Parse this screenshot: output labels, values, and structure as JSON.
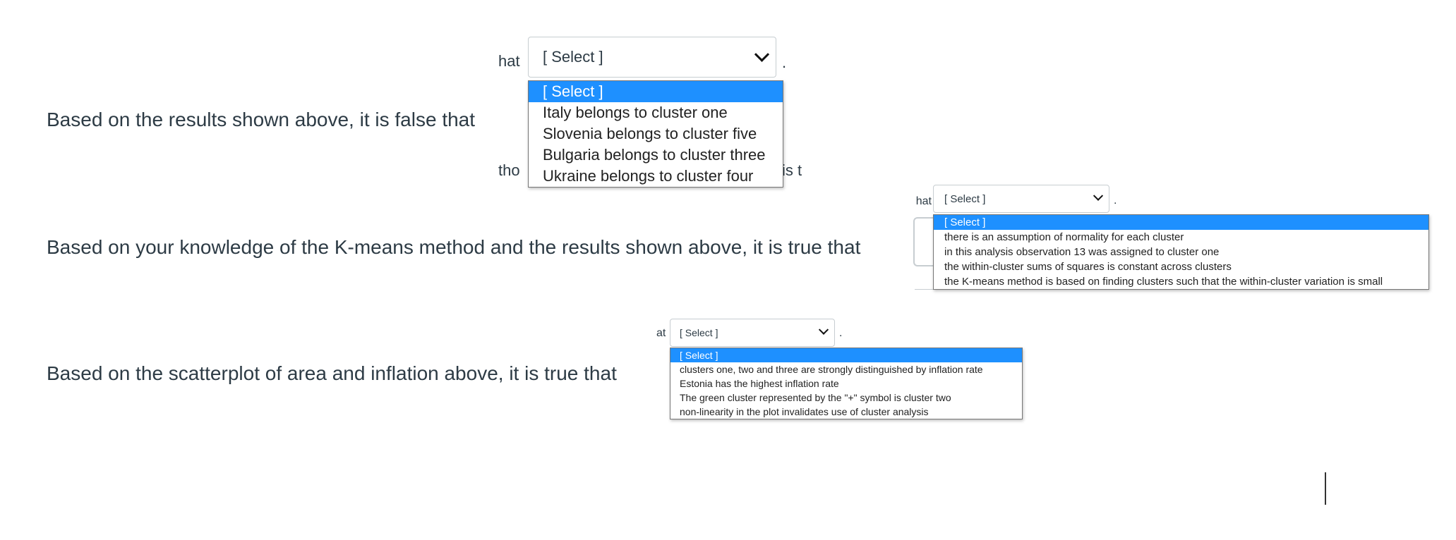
{
  "questions": [
    {
      "text": "Based on the results shown above, it is false that",
      "fragment_before": "hat",
      "fragment_below_left": "tho",
      "fragment_below_right": "is t",
      "select_value": "[ Select ]",
      "period": ".",
      "options": [
        "[ Select ]",
        "Italy belongs to cluster one",
        "Slovenia belongs to cluster five",
        "Bulgaria belongs to cluster three",
        "Ukraine belongs to cluster four"
      ]
    },
    {
      "text": "Based on your knowledge of the K-means method and the results shown above, it is true that",
      "fragment_before": "hat",
      "select_value": "[ Select ]",
      "period": ".",
      "options": [
        "[ Select ]",
        "there is an assumption of normality for each cluster",
        "in this analysis observation 13 was assigned to cluster one",
        "the within-cluster sums of squares is constant across clusters",
        "the K-means method is based on finding clusters such that the within-cluster variation is small"
      ]
    },
    {
      "text": "Based on the scatterplot of area and inflation above, it is true that",
      "fragment_before": "at",
      "select_value": "[ Select ]",
      "period": ".",
      "options": [
        "[ Select ]",
        "clusters one, two and three are strongly distinguished by inflation rate",
        "Estonia has the highest inflation rate",
        "The green cluster represented by the \"+\" symbol is cluster two",
        "non-linearity in the plot invalidates use of cluster analysis"
      ]
    }
  ],
  "colors": {
    "highlight": "#1e90ff",
    "text": "#2d3b45",
    "border": "#c7cdd1"
  },
  "icons": {
    "select_arrow": "chevron-down-icon"
  }
}
